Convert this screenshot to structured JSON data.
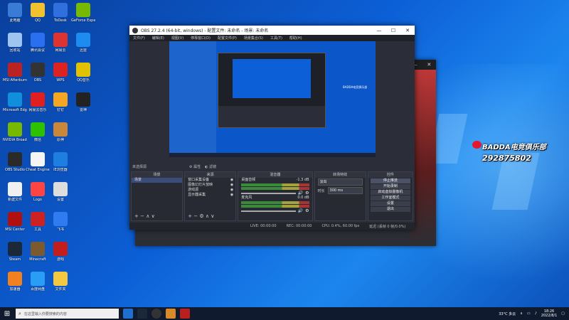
{
  "desktop": {
    "icons": [
      {
        "label": "此电脑",
        "color": "#3a7bd5",
        "col": 0,
        "row": 0
      },
      {
        "label": "QQ",
        "color": "#f2c12e",
        "col": 1,
        "row": 0
      },
      {
        "label": "ToDesk",
        "color": "#2f6fde",
        "col": 2,
        "row": 0
      },
      {
        "label": "GeForce Experience",
        "color": "#76b900",
        "col": 3,
        "row": 0
      },
      {
        "label": "回收站",
        "color": "#9ec5f0",
        "col": 0,
        "row": 1
      },
      {
        "label": "腾讯会议",
        "color": "#2a6ff0",
        "col": 1,
        "row": 1
      },
      {
        "label": "网易云",
        "color": "#d33",
        "col": 2,
        "row": 1
      },
      {
        "label": "迅雷",
        "color": "#1d8cf0",
        "col": 3,
        "row": 1
      },
      {
        "label": "MSI Afterburner",
        "color": "#b22",
        "col": 0,
        "row": 2
      },
      {
        "label": "OBS",
        "color": "#333",
        "col": 1,
        "row": 2
      },
      {
        "label": "WPS",
        "color": "#d22",
        "col": 2,
        "row": 2
      },
      {
        "label": "QQ音乐",
        "color": "#e0c200",
        "col": 3,
        "row": 2
      },
      {
        "label": "Microsoft Edge",
        "color": "#0f8fdc",
        "col": 0,
        "row": 3
      },
      {
        "label": "网易云音乐",
        "color": "#e02020",
        "col": 1,
        "row": 3
      },
      {
        "label": "钉钉",
        "color": "#f5a623",
        "col": 2,
        "row": 3
      },
      {
        "label": "雷神",
        "color": "#222",
        "col": 3,
        "row": 3
      },
      {
        "label": "NVIDIA Broadcast",
        "color": "#76b900",
        "col": 0,
        "row": 4
      },
      {
        "label": "微信",
        "color": "#2dc100",
        "col": 1,
        "row": 4
      },
      {
        "label": "原神",
        "color": "#c8873a",
        "col": 2,
        "row": 4
      },
      {
        "label": "OBS Studio",
        "color": "#2a2a2a",
        "col": 0,
        "row": 5
      },
      {
        "label": "Cheat Engine",
        "color": "#f5f5f5",
        "col": 1,
        "row": 5
      },
      {
        "label": "IE浏览器",
        "color": "#1f7fe0",
        "col": 2,
        "row": 5
      },
      {
        "label": "新建文件",
        "color": "#f0f0f0",
        "col": 0,
        "row": 6
      },
      {
        "label": "Logo",
        "color": "#ff4444",
        "col": 1,
        "row": 6
      },
      {
        "label": "设置",
        "color": "#ddd",
        "col": 2,
        "row": 6
      },
      {
        "label": "MSI Center",
        "color": "#b01010",
        "col": 0,
        "row": 7
      },
      {
        "label": "工具",
        "color": "#c22",
        "col": 1,
        "row": 7
      },
      {
        "label": "飞书",
        "color": "#2f7bf0",
        "col": 2,
        "row": 7
      },
      {
        "label": "Steam",
        "color": "#1b2838",
        "col": 0,
        "row": 8
      },
      {
        "label": "Minecraft",
        "color": "#7a5a2e",
        "col": 1,
        "row": 8
      },
      {
        "label": "游戏",
        "color": "#c21e1e",
        "col": 2,
        "row": 8
      },
      {
        "label": "加速器",
        "color": "#f08020",
        "col": 0,
        "row": 9
      },
      {
        "label": "百度网盘",
        "color": "#2a9df4",
        "col": 1,
        "row": 9
      },
      {
        "label": "文件夹",
        "color": "#f5c842",
        "col": 2,
        "row": 9
      }
    ]
  },
  "obs": {
    "title": "OBS 27.2.4 (64-bit, windows) - 配置文件: 未命名 - 场景: 未命名",
    "menu": [
      "文件(F)",
      "编辑(E)",
      "视图(V)",
      "停靠窗口(D)",
      "配置文件(P)",
      "场景集合(S)",
      "工具(T)",
      "帮助(H)"
    ],
    "scene_bar": {
      "label": "未选择源",
      "props": "属性",
      "filters": "滤镜"
    },
    "scenes": {
      "header": "场景",
      "items": [
        "场景"
      ]
    },
    "sources": {
      "header": "来源",
      "items": [
        "窗口采集设备",
        "图像幻灯片放映",
        "游戏源",
        "显示器采集"
      ]
    },
    "mixer": {
      "header": "混音器",
      "tracks": [
        {
          "name": "桌面音频",
          "db": "-1.3 dB"
        },
        {
          "name": "麦克风",
          "db": "0.0 dB"
        }
      ]
    },
    "transitions": {
      "header": "转场特效",
      "type": "淡出",
      "duration_label": "时长",
      "duration": "300 ms"
    },
    "controls": {
      "header": "控件",
      "buttons": [
        "停止推流",
        "开始录制",
        "启动虚拟摄像机",
        "工作室模式",
        "设置",
        "退出"
      ]
    },
    "status": {
      "live": "LIVE: 00:00:00",
      "rec": "REC: 00:00:00",
      "cpu": "CPU: 0.4%, 60.00 fps",
      "delay": "延迟 (丢帧 0 帧/0.0%)"
    }
  },
  "overlay": {
    "line1": "BADDA电竞俱乐部",
    "line2": "292875802"
  },
  "taskbar": {
    "search_placeholder": "在这里输入你要搜索的内容",
    "weather": "33°C 多云",
    "time": "18:26",
    "date": "2022/8/1"
  }
}
